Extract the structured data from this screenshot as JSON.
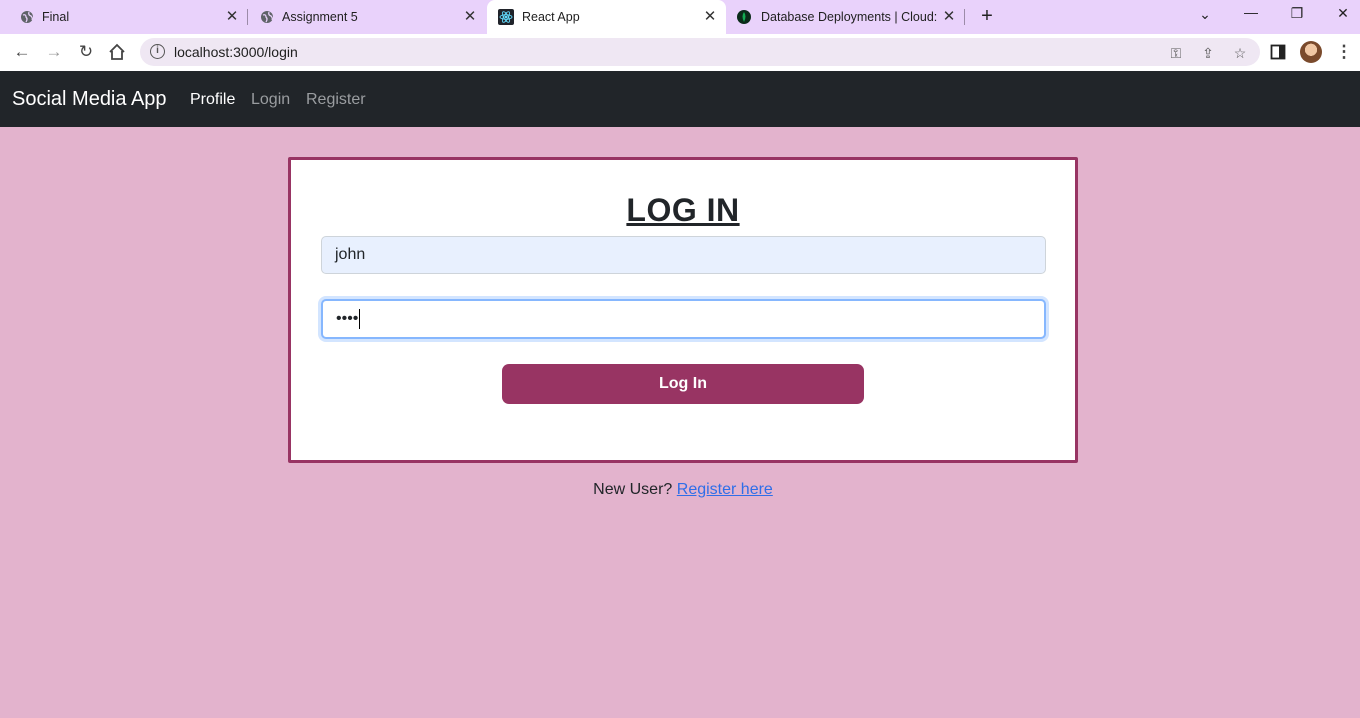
{
  "browser": {
    "tabs": [
      {
        "title": "Final",
        "icon": "globe-icon"
      },
      {
        "title": "Assignment 5",
        "icon": "globe-icon"
      },
      {
        "title": "React App",
        "icon": "react-icon"
      },
      {
        "title": "Database Deployments | Cloud: M",
        "icon": "mongodb-icon"
      }
    ],
    "active_tab_index": 2,
    "url": "localhost:3000/login",
    "tab_bar_color": "#e9d2fb"
  },
  "navbar": {
    "brand": "Social Media App",
    "links": [
      "Profile",
      "Login",
      "Register"
    ],
    "background": "#212529"
  },
  "login": {
    "title": "LOG IN",
    "username_value": "john",
    "password_mask": "••••",
    "submit_label": "Log In",
    "accent_color": "#983463"
  },
  "footer": {
    "prompt": "New User?",
    "link_text": "Register here"
  },
  "page_background": "#e3b3cd"
}
